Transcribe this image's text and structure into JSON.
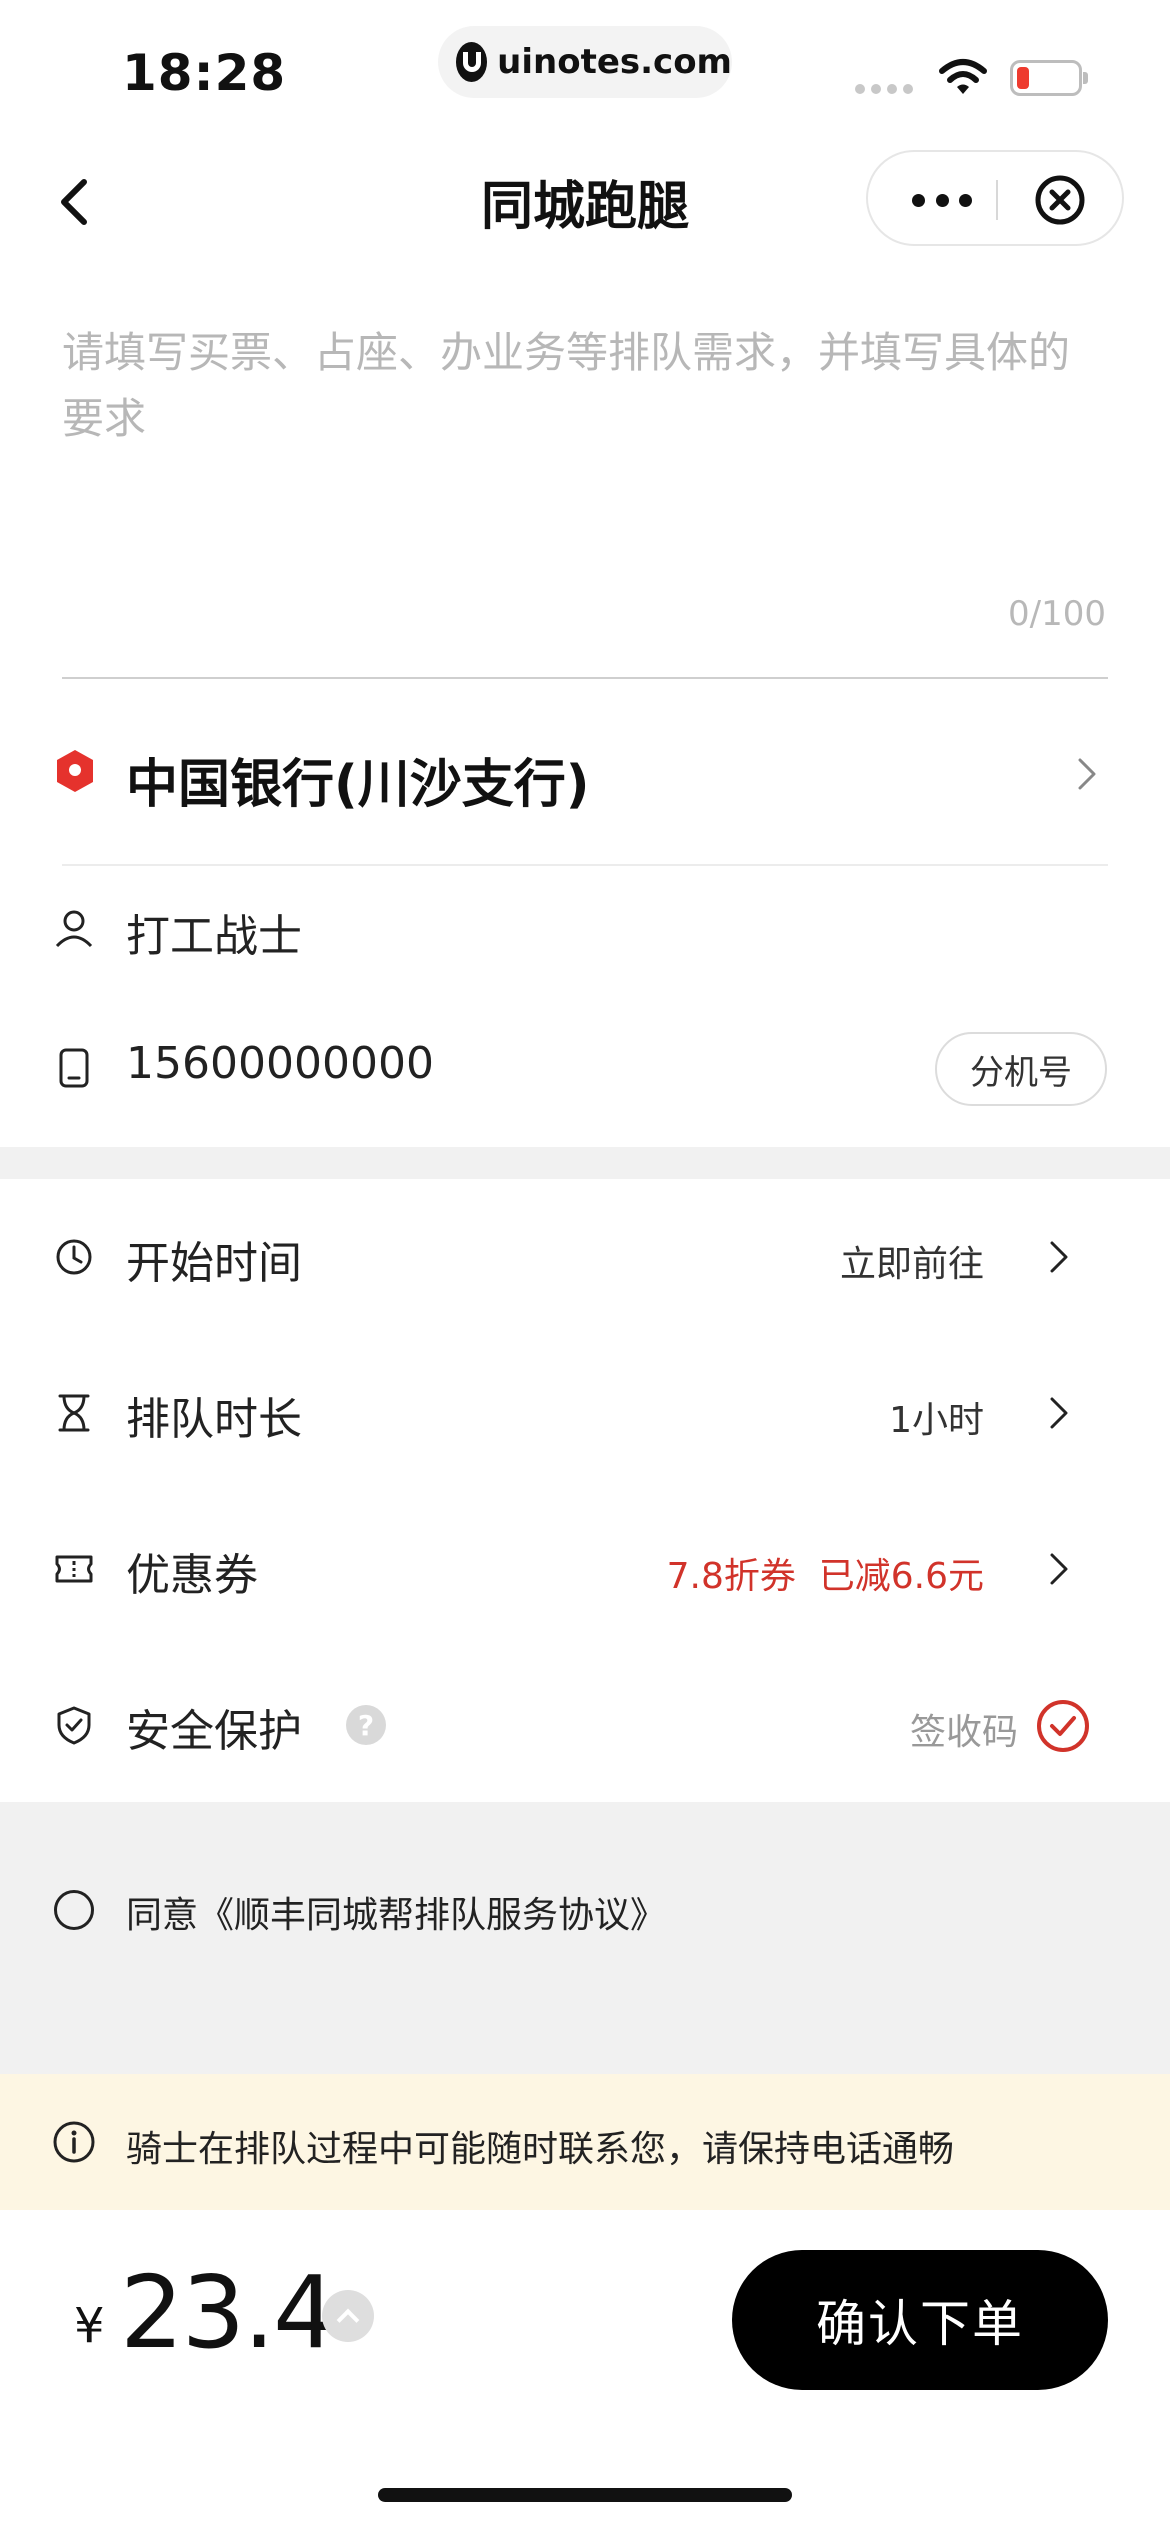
{
  "status_bar": {
    "time": "18:28",
    "url": "uinotes.com",
    "battery_color": "#ee3b2f"
  },
  "nav": {
    "title": "同城跑腿",
    "icons": [
      "back-arrow-icon",
      "more-icon",
      "close-circle-icon"
    ]
  },
  "request": {
    "placeholder": "请填写买票、占座、办业务等排队需求，并填写具体的要求",
    "counter": "0/100"
  },
  "address": {
    "location_name": "中国银行(川沙支行)",
    "contact_name": "打工战士",
    "phone": "15600000000",
    "extension_label": "分机号"
  },
  "settings": {
    "start_time": {
      "label": "开始时间",
      "value": "立即前往"
    },
    "queue_duration": {
      "label": "排队时长",
      "value": "1小时"
    },
    "coupon": {
      "label": "优惠券",
      "value": "7.8折券  已减6.6元",
      "value_color": "#d1332a"
    },
    "safety": {
      "label": "安全保护",
      "help": "?",
      "value": "签收码",
      "checked": true,
      "check_color": "#d1332a"
    }
  },
  "agreement": {
    "text": "同意《顺丰同城帮排队服务协议》",
    "checked": false
  },
  "notice": {
    "text": "骑士在排队过程中可能随时联系您，请保持电话通畅"
  },
  "footer": {
    "currency": "¥",
    "price": "23.4",
    "confirm_label": "确认下单"
  }
}
